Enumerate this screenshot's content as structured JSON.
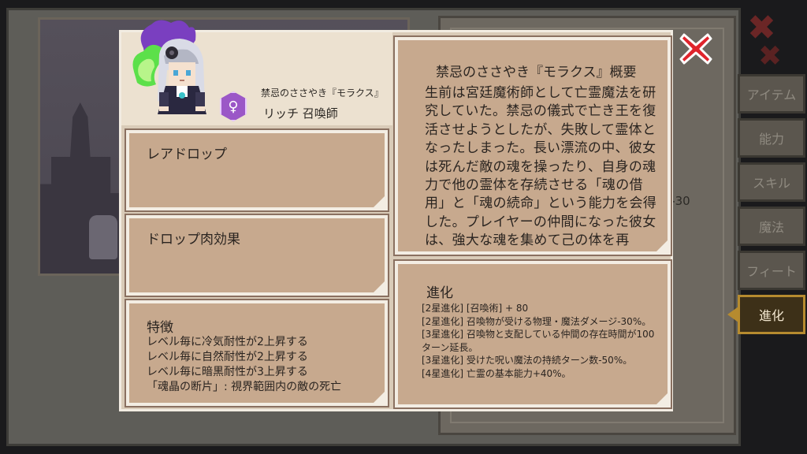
{
  "character": {
    "name": "禁忌のささやき『モラクス』",
    "class": "リッチ 召喚師",
    "gender_symbol": "♀"
  },
  "rare_drop": {
    "title": "レアドロップ"
  },
  "meat_effect": {
    "title": "ドロップ肉効果"
  },
  "traits": {
    "title": "特徴",
    "lines": [
      "レベル毎に冷気耐性が2上昇する",
      "レベル毎に自然耐性が2上昇する",
      "レベル毎に暗黒耐性が3上昇する",
      "「魂晶の断片」: 視界範囲内の敵の死亡"
    ]
  },
  "overview": {
    "title": "禁忌のささやき『モラクス』概要",
    "body": "生前は宮廷魔術師として亡霊魔法を研究していた。禁忌の儀式で亡き王を復活させようとしたが、失敗して霊体となったしまった。長い漂流の中、彼女は死んだ敵の魂を操ったり、自身の魂力で他の霊体を存続させる「魂の借用」と「魂の続命」という能力を会得した。プレイヤーの仲間になった彼女は、強大な魂を集めて己の体を再"
  },
  "evolution": {
    "title": "進化",
    "lines": [
      "[2星進化] [召喚術] + 80",
      "[2星進化] 召喚物が受ける物理・魔法ダメージ-30%。",
      "[3星進化] 召喚物と支配している仲間の存在時間が100ターン延長。",
      "[3星進化] 受けた呪い魔法の持続ターン数-50%。",
      "[4星進化] 亡霊の基本能力+40%。"
    ]
  },
  "tabs": [
    {
      "label": "アイテム",
      "active": false
    },
    {
      "label": "能力",
      "active": false
    },
    {
      "label": "スキル",
      "active": false
    },
    {
      "label": "魔法",
      "active": false
    },
    {
      "label": "フィート",
      "active": false
    },
    {
      "label": "進化",
      "active": true
    }
  ],
  "background": {
    "partial_text": "ř-30"
  },
  "colors": {
    "popup_bg": "#d9cbb8",
    "card_bg": "#c7a98e",
    "close_red": "#e0242c",
    "active_tab_border": "#b68b2f",
    "gender_purple": "#9b57c7"
  }
}
